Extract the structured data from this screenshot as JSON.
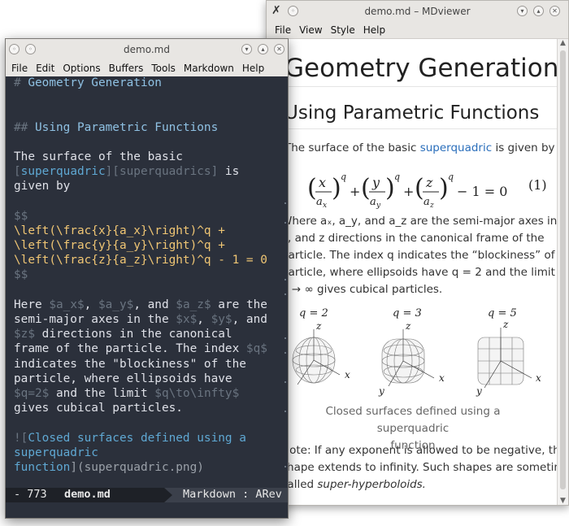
{
  "viewer": {
    "title": "demo.md – MDviewer",
    "menu": [
      "File",
      "View",
      "Style",
      "Help"
    ],
    "h1": "Geometry Generation",
    "h2": "Using Parametric Functions",
    "para1_pre": "The surface of the basic ",
    "para1_link": "superquadric",
    "para1_post": " is given by",
    "equation": "(x/aₓ)^q + (y/a_y)^q + (z/a_z)^q − 1 = 0",
    "equation_number": "(1)",
    "para2_lines": [
      "Where aₓ, a_y, and a_z are the semi-major axes in the x,",
      "y, and z directions in the canonical frame of the",
      "particle. The index q indicates the “blockiness” of the",
      "particle, where ellipsoids have q = 2 and the limit",
      "q → ∞ gives cubical particles."
    ],
    "plots": [
      {
        "q_label": "q = 2"
      },
      {
        "q_label": "q = 3"
      },
      {
        "q_label": "q = 5"
      }
    ],
    "axis_labels": {
      "x": "x",
      "y": "y",
      "z": "z"
    },
    "caption_lines": [
      "Closed surfaces defined using a superquadric",
      "function"
    ],
    "note_lines": [
      "Note: If any exponent is allowed to be negative, the",
      "shape extends to infinity. Such shapes are sometimes",
      "called "
    ],
    "note_emph": "super-hyperboloids."
  },
  "editor": {
    "title": "demo.md",
    "menu": [
      "File",
      "Edit",
      "Options",
      "Buffers",
      "Tools",
      "Markdown",
      "Help"
    ],
    "modeline_left": "- 773",
    "modeline_buffer": "demo.md",
    "modeline_mode": "Markdown : ARev",
    "lines": {
      "l1_hash": "# ",
      "l1_text": "Geometry Generation",
      "l4_hash": "## ",
      "l4_text": "Using Parametric Functions",
      "l6": "The surface of the basic",
      "l7_a": "[",
      "l7_b": "superquadric",
      "l7_c": "][superquadrics]",
      "l7_d": " is",
      "l8": "given by",
      "l10": "$$",
      "l11": "\\left(\\frac{x}{a_x}\\right)^q +",
      "l12": "\\left(\\frac{y}{a_y}\\right)^q +",
      "l13": "\\left(\\frac{z}{a_z}\\right)^q - 1 = 0",
      "l14": "$$",
      "l16_a": "Here ",
      "l16_b": "$a_x$",
      "l16_c": ", ",
      "l16_d": "$a_y$",
      "l16_e": ", and ",
      "l16_f": "$a_z$",
      "l16_g": " are the",
      "l17_a": "semi-major axes in the ",
      "l17_b": "$x$",
      "l17_c": ", ",
      "l17_d": "$y$",
      "l17_e": ", and",
      "l18_a": "$z$",
      "l18_b": " directions in the canonical",
      "l19_a": "frame of the particle. The index ",
      "l19_b": "$q$",
      "l20": "indicates the \"blockiness\" of the",
      "l21": "particle, where ellipsoids have",
      "l22_a": "$q=2$",
      "l22_b": " and the limit ",
      "l22_c": "$q\\to\\infty$",
      "l23": "gives cubical particles.",
      "l25_a": "![",
      "l25_b": "Closed surfaces defined using a",
      "l26": "superquadric",
      "l27_a": "function",
      "l27_b": "](superquadric.png)"
    }
  }
}
